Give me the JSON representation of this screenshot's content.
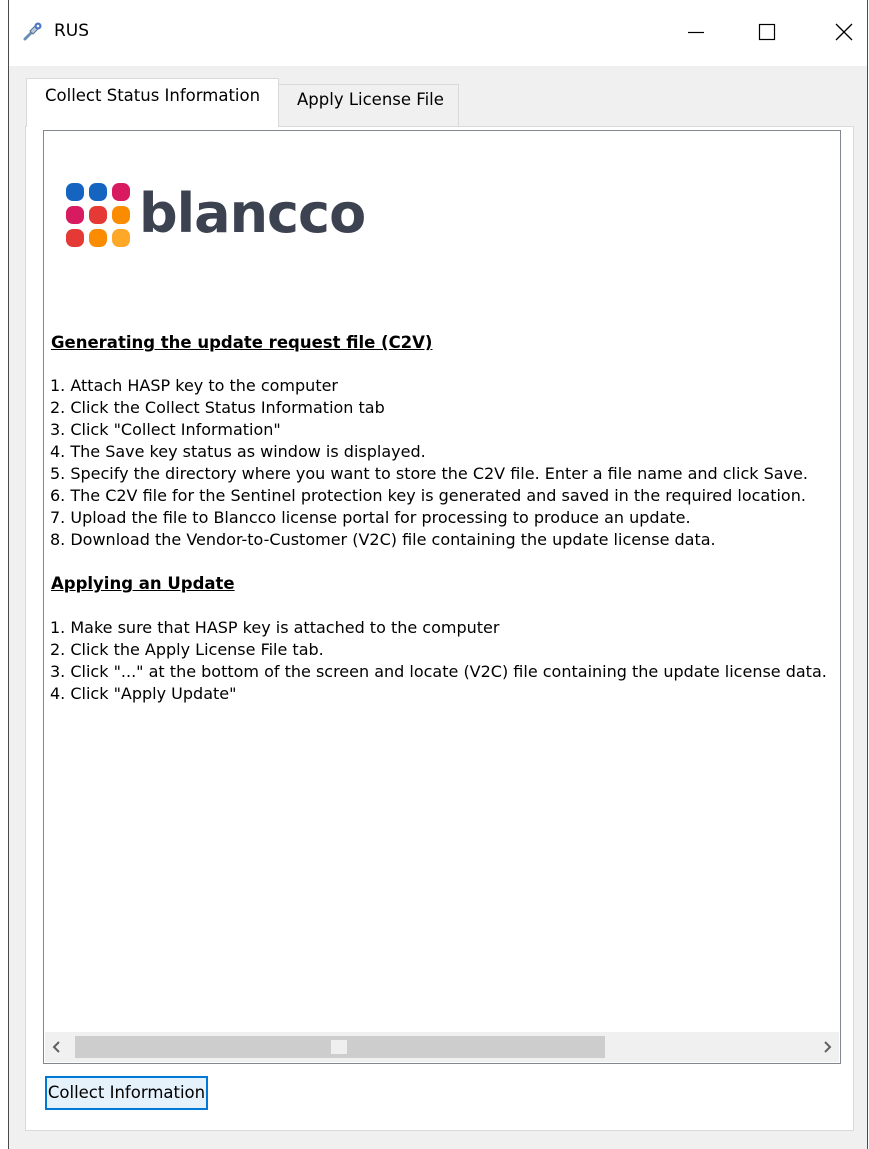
{
  "window": {
    "title": "RUS"
  },
  "tabs": [
    {
      "label": "Collect Status Information",
      "active": true
    },
    {
      "label": "Apply License File",
      "active": false
    }
  ],
  "logo": {
    "text": "blancco",
    "dot_colors": [
      "#1565c0",
      "#1565c0",
      "#d81b60",
      "#d81b60",
      "#e53935",
      "#fb8c00",
      "#e53935",
      "#fb8c00",
      "#ffa726"
    ]
  },
  "sections": [
    {
      "heading": "Generating the update request file (C2V)",
      "items": [
        "1. Attach HASP key to the computer",
        "2. Click the Collect Status Information tab",
        "3. Click \"Collect Information\"",
        "4. The Save key status as window is displayed.",
        "5. Specify the directory where you want to store the C2V file. Enter a file name and click Save.",
        "6. The C2V file for the Sentinel protection key is generated and saved in the required location.",
        "7. Upload the file to Blancco license portal for processing to produce an update.",
        "8. Download the Vendor-to-Customer (V2C) file containing the update license data."
      ]
    },
    {
      "heading": "Applying an Update ",
      "items": [
        "1. Make sure that HASP key is attached to the computer",
        "2. Click the Apply License File tab.",
        "3. Click \"...\" at the bottom of the screen and locate (V2C) file containing the update license data.",
        "4. Click \"Apply Update\""
      ]
    }
  ],
  "buttons": {
    "collect": "Collect Information"
  }
}
